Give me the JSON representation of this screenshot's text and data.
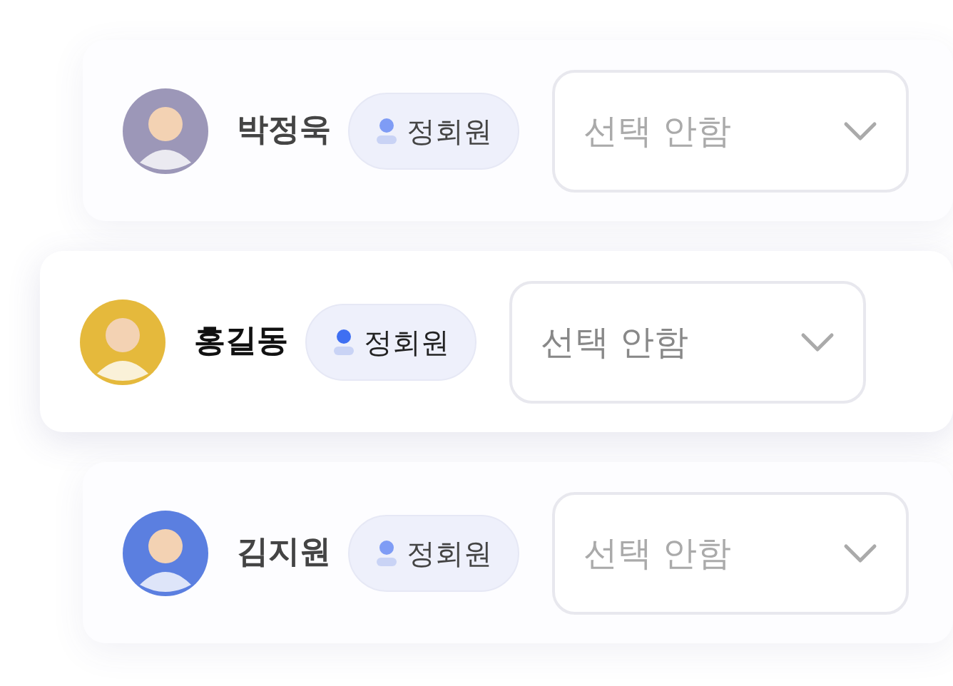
{
  "members": [
    {
      "name": "박정욱",
      "badge": "정회원",
      "dropdown": {
        "value": "선택 안함"
      },
      "color": "#9c97b8",
      "selected": false
    },
    {
      "name": "홍길동",
      "badge": "정회원",
      "dropdown": {
        "value": "선택 안함"
      },
      "color": "#e5b93c",
      "selected": true
    },
    {
      "name": "김지원",
      "badge": "정회원",
      "dropdown": {
        "value": "선택 안함"
      },
      "color": "#5b7fe0",
      "selected": false
    }
  ]
}
